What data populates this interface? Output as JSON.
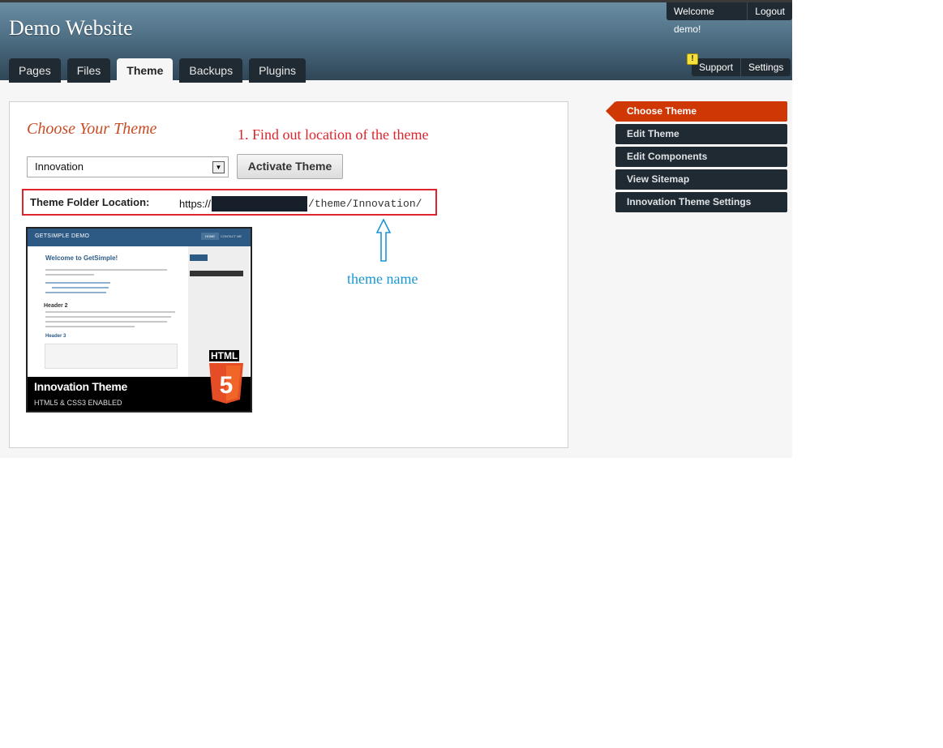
{
  "header": {
    "site_title": "Demo Website",
    "welcome": "Welcome demo!",
    "logout": "Logout",
    "support": "Support",
    "settings": "Settings",
    "alert_symbol": "!"
  },
  "tabs": [
    {
      "label": "Pages",
      "active": false
    },
    {
      "label": "Files",
      "active": false
    },
    {
      "label": "Theme",
      "active": true
    },
    {
      "label": "Backups",
      "active": false
    },
    {
      "label": "Plugins",
      "active": false
    }
  ],
  "main": {
    "title": "Choose Your Theme",
    "annotation_step": "1. Find out location of the theme",
    "select_value": "Innovation",
    "activate_label": "Activate Theme",
    "location_label": "Theme Folder Location:",
    "location_prefix": "https://",
    "location_path": "/theme/Innovation/",
    "annotation_theme_name": "theme name"
  },
  "preview": {
    "site_name": "GETSIMPLE DEMO",
    "nav_home": "HOME",
    "nav_contact": "CONTACT ME",
    "welcome": "Welcome to GetSimple!",
    "header2": "Header 2",
    "header3": "Header 3",
    "banner_title": "Innovation Theme",
    "banner_subtitle": "HTML5 & CSS3 ENABLED",
    "html_label": "HTML",
    "html5_number": "5"
  },
  "sidebar": {
    "items": [
      {
        "label": "Choose Theme",
        "active": true
      },
      {
        "label": "Edit Theme",
        "active": false
      },
      {
        "label": "Edit Components",
        "active": false
      },
      {
        "label": "View Sitemap",
        "active": false
      },
      {
        "label": "Innovation Theme Settings",
        "active": false
      }
    ]
  },
  "colors": {
    "accent": "#cf3805",
    "annotation_red": "#e0242b",
    "annotation_blue": "#1a97d4"
  }
}
